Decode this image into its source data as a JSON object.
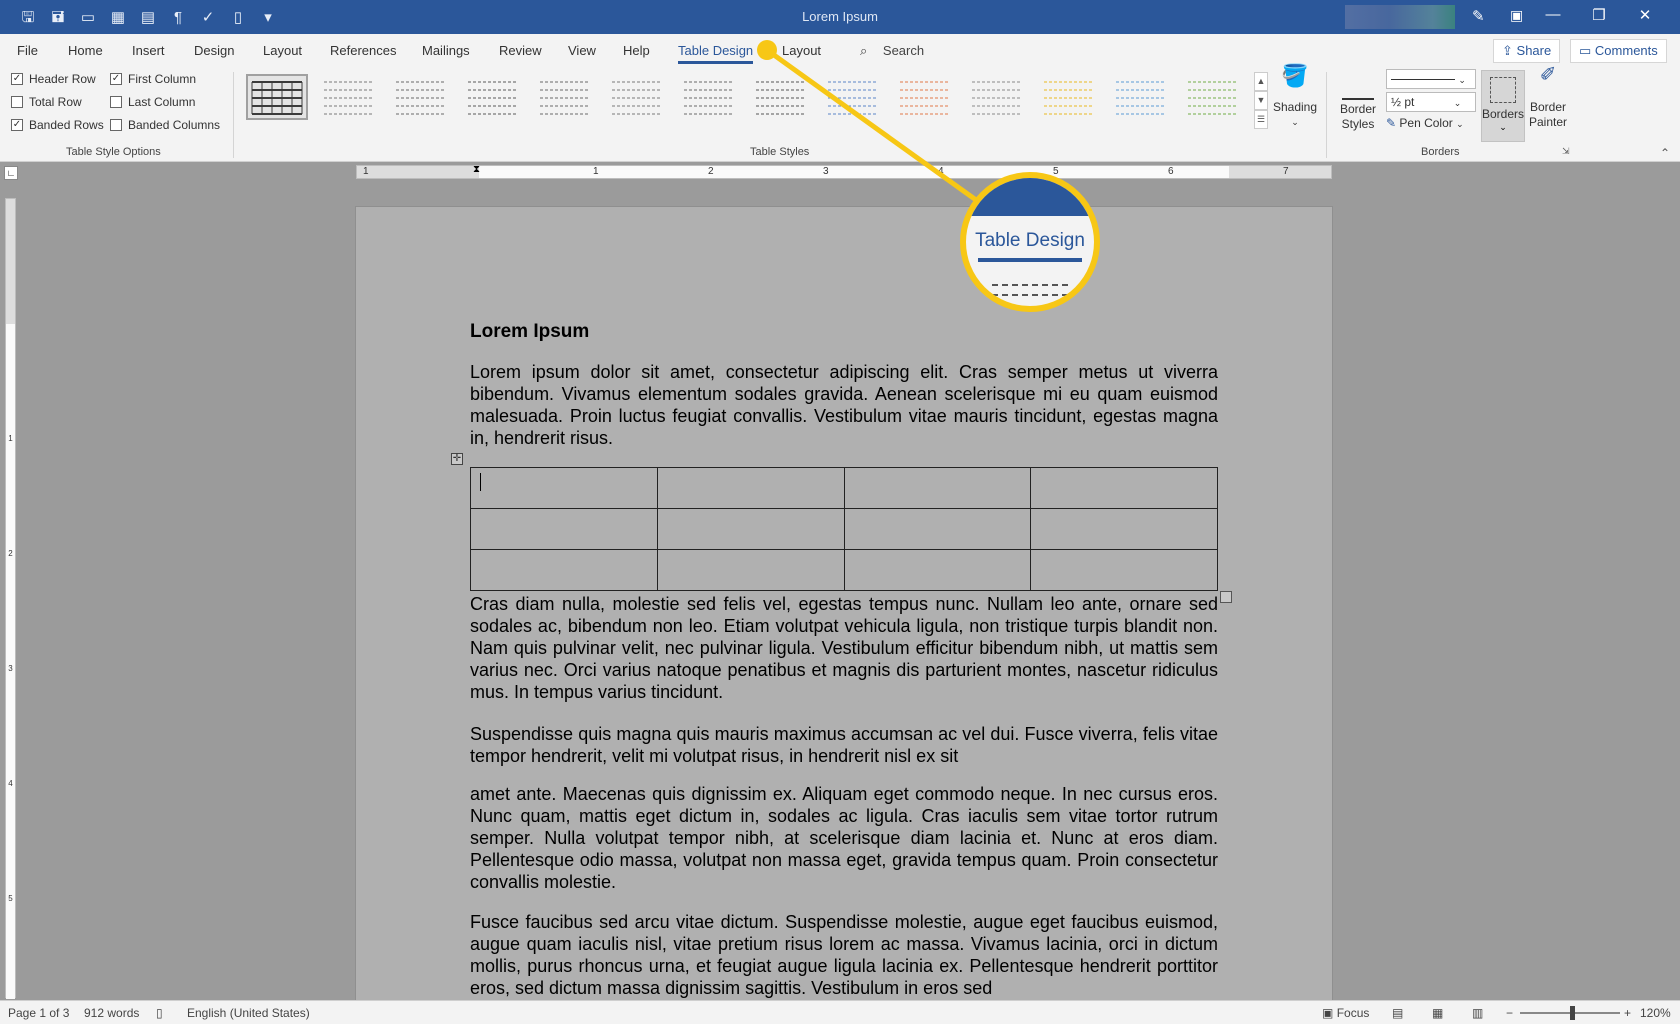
{
  "window": {
    "title": "Lorem Ipsum",
    "controls": [
      "—",
      "❐",
      "✕"
    ]
  },
  "quick_access": [
    "save-icon",
    "save-as-icon",
    "open-icon",
    "table-icon",
    "layout-icon",
    "paragraph-icon",
    "spelling-icon",
    "new-doc-icon",
    "customize-icon"
  ],
  "tabs": {
    "items": [
      {
        "label": "File"
      },
      {
        "label": "Home"
      },
      {
        "label": "Insert"
      },
      {
        "label": "Design"
      },
      {
        "label": "Layout"
      },
      {
        "label": "References"
      },
      {
        "label": "Mailings"
      },
      {
        "label": "Review"
      },
      {
        "label": "View"
      },
      {
        "label": "Help"
      },
      {
        "label": "Table Design"
      },
      {
        "label": "Layout"
      }
    ],
    "active": "Table Design",
    "search_label": "Search",
    "share_label": "Share",
    "comments_label": "Comments"
  },
  "ribbon": {
    "style_options": {
      "group_label": "Table Style Options",
      "items": [
        {
          "label": "Header Row",
          "checked": "✓"
        },
        {
          "label": "First Column",
          "checked": "✓"
        },
        {
          "label": "Total Row",
          "checked": ""
        },
        {
          "label": "Last Column",
          "checked": ""
        },
        {
          "label": "Banded Rows",
          "checked": "✓"
        },
        {
          "label": "Banded Columns",
          "checked": ""
        }
      ]
    },
    "table_styles": {
      "group_label": "Table Styles",
      "accent_colors": [
        "#3b3b3b",
        "#7a7a7a",
        "#6a6a6a",
        "#5a5a5a",
        "#6a6a6a",
        "#7a7a7a",
        "#6a6a6a",
        "#555555",
        "#5b86c7",
        "#e07a4a",
        "#8a8a8a",
        "#e8b820",
        "#5b9bd5",
        "#70ad47"
      ]
    },
    "shading_label": "Shading",
    "border_styles_label": "Border Styles",
    "border_styles_line1": "Border",
    "border_styles_line2": "Styles",
    "pen_weight": "½ pt",
    "pen_color_label": "Pen Color",
    "borders_label": "Borders",
    "border_painter_line1": "Border",
    "border_painter_line2": "Painter",
    "borders_group_label": "Borders"
  },
  "ruler": {
    "h_numbers": [
      "1",
      "1",
      "2",
      "3",
      "4",
      "5",
      "6",
      "7"
    ],
    "v_numbers": [
      "1",
      "2",
      "3",
      "4",
      "5"
    ]
  },
  "document": {
    "heading": "Lorem Ipsum",
    "para1": "Lorem ipsum dolor sit amet, consectetur adipiscing elit. Cras semper metus ut viverra bibendum. Vivamus elementum sodales gravida. Aenean scelerisque mi eu quam euismod malesuada. Proin luctus feugiat convallis. Vestibulum vitae mauris tincidunt, egestas magna in, hendrerit risus.",
    "para2": "Cras diam nulla, molestie sed felis vel, egestas tempus nunc. Nullam leo ante, ornare sed sodales ac, bibendum non leo. Etiam volutpat vehicula ligula, non tristique turpis blandit non. Nam quis pulvinar velit, nec pulvinar ligula. Vestibulum efficitur bibendum nibh, ut mattis sem varius nec. Orci varius natoque penatibus et magnis dis parturient montes, nascetur ridiculus mus. In tempus varius tincidunt.",
    "para3": "Suspendisse quis magna quis mauris maximus accumsan ac vel dui. Fusce viverra, felis vitae tempor hendrerit, velit mi volutpat risus, in hendrerit nisl ex sit",
    "para4": "amet ante. Maecenas quis dignissim ex. Aliquam eget commodo neque. In nec cursus eros. Nunc quam, mattis eget dictum in, sodales ac ligula. Cras iaculis sem vitae tortor rutrum semper. Nulla volutpat tempor nibh, at scelerisque diam lacinia et. Nunc at eros diam. Pellentesque odio massa, volutpat non massa eget, gravida tempus quam. Proin consectetur convallis molestie.",
    "para5": "Fusce faucibus sed arcu vitae dictum. Suspendisse molestie, augue eget faucibus euismod, augue quam iaculis nisl, vitae pretium risus lorem ac massa. Vivamus lacinia, orci in dictum mollis, purus rhoncus urna, et feugiat augue ligula lacinia ex. Pellentesque hendrerit porttitor eros, sed dictum massa dignissim sagittis. Vestibulum in eros sed",
    "table": {
      "rows": 3,
      "cols": 4
    }
  },
  "callout": {
    "label": "Table Design",
    "color": "#f7c715"
  },
  "status": {
    "page": "Page 1 of 3",
    "words": "912 words",
    "language": "English (United States)",
    "focus": "Focus",
    "zoom": "120%",
    "zoom_minus": "−",
    "zoom_plus": "+"
  }
}
